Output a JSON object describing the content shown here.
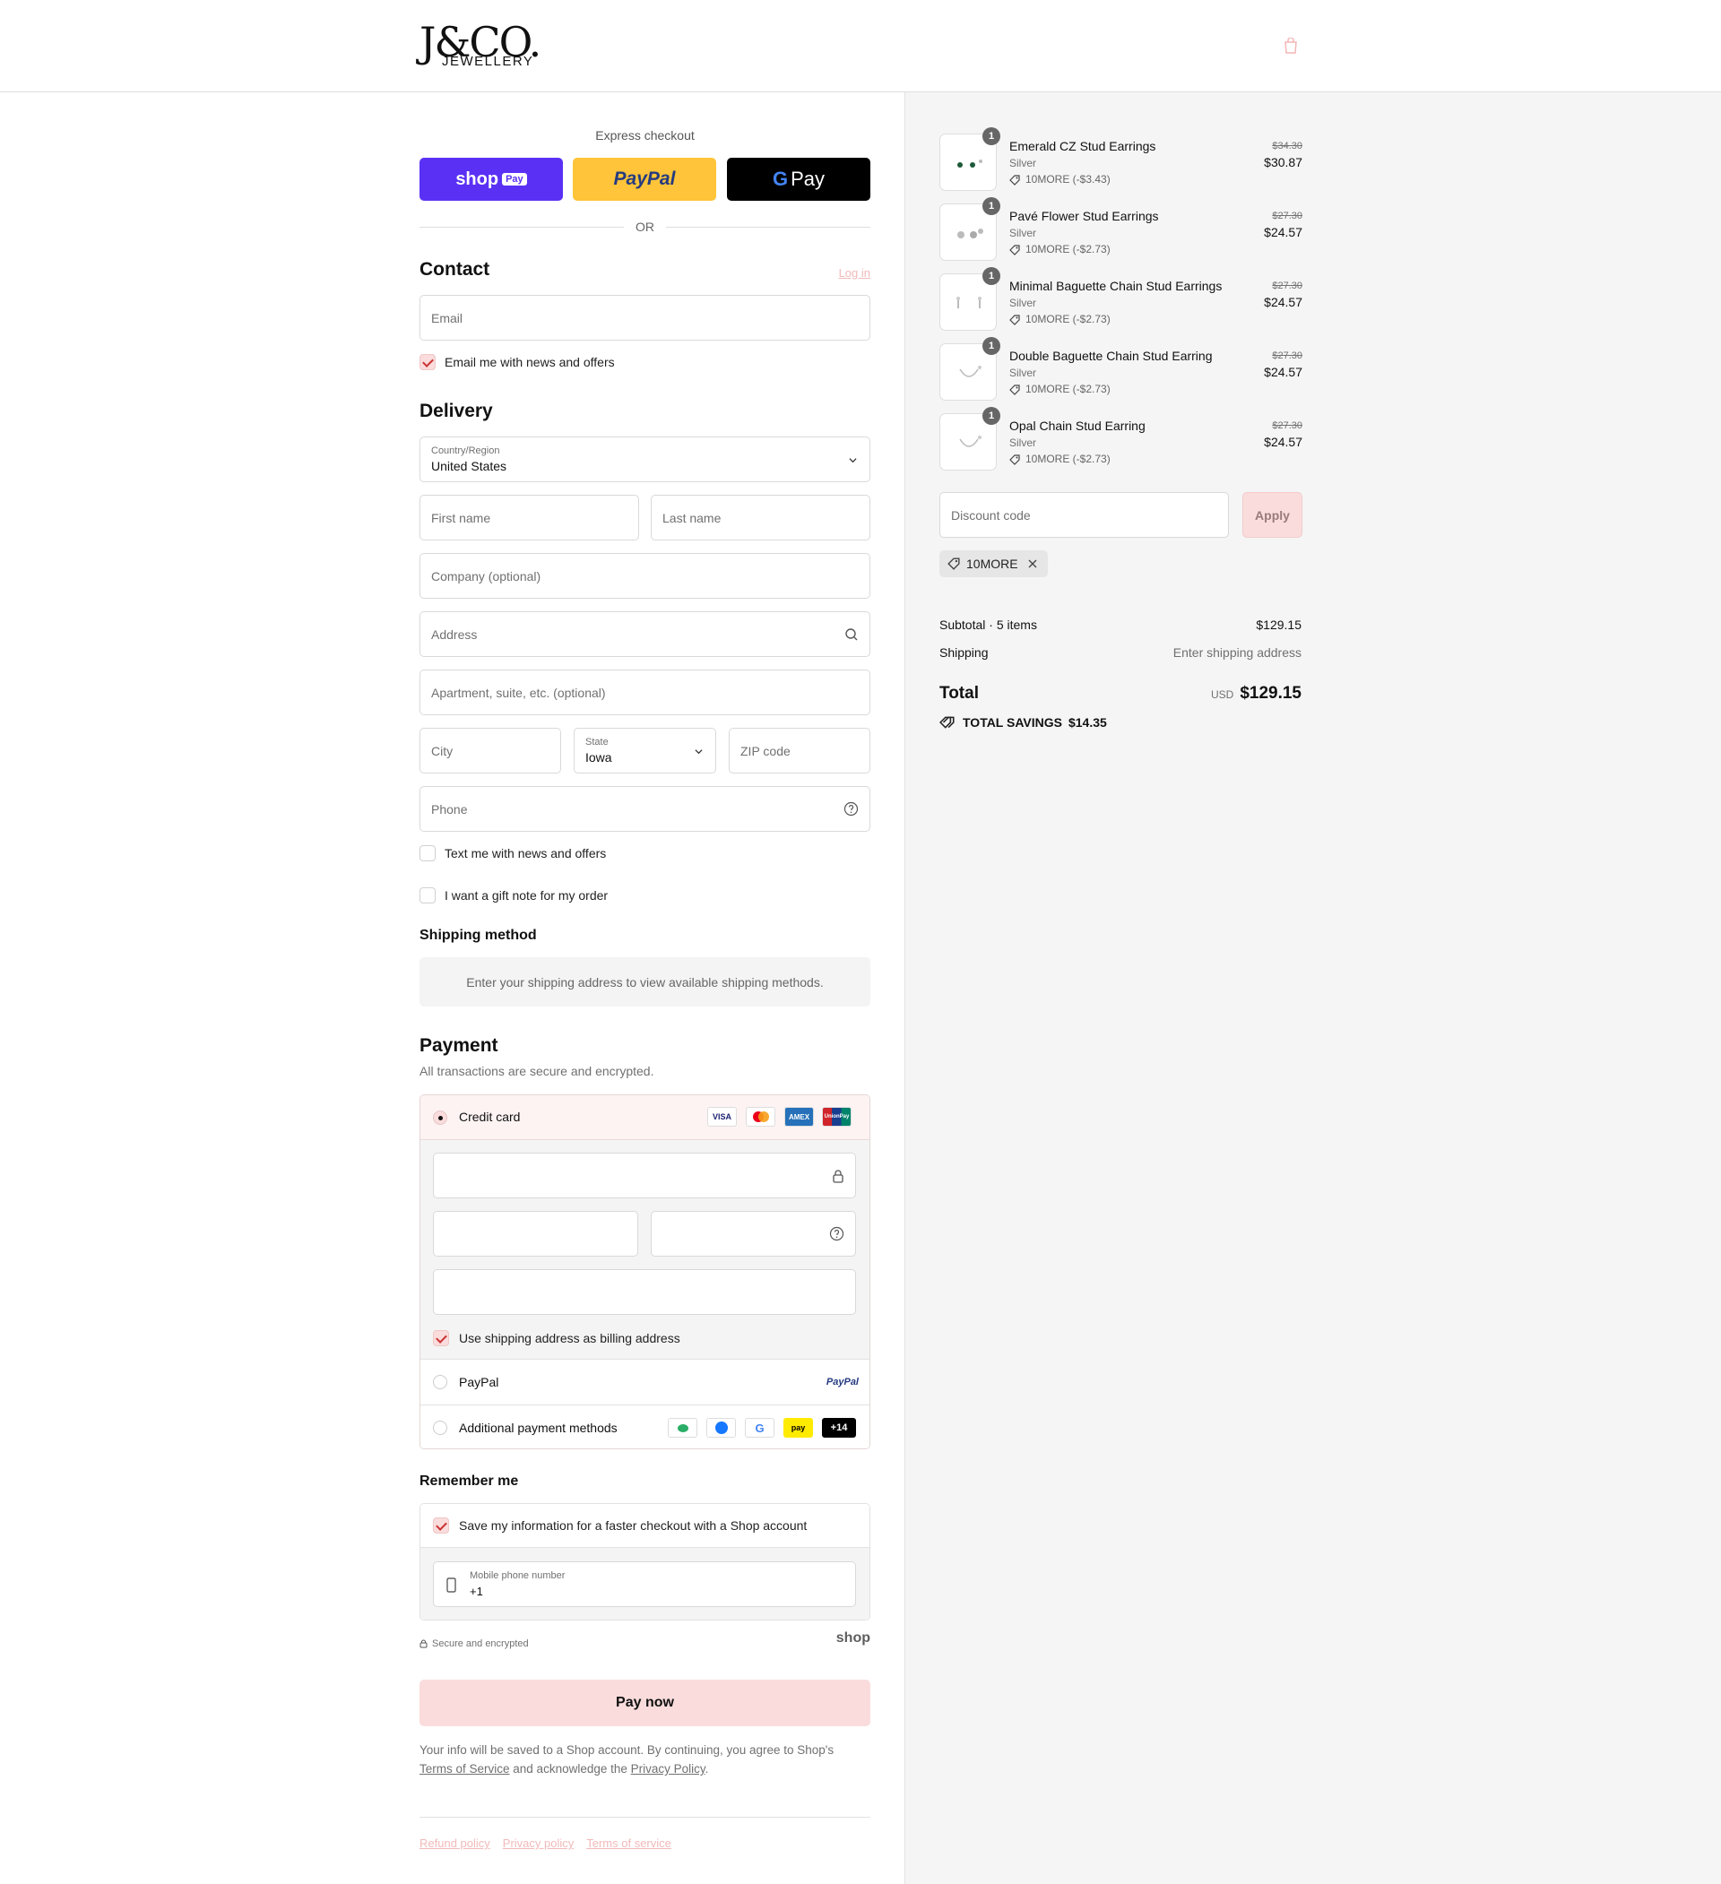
{
  "brand": {
    "logo_main": "J&CO.",
    "logo_sub": "JEWELLERY"
  },
  "express": {
    "title": "Express checkout",
    "shop_pay": "shop",
    "shop_pay_badge": "Pay",
    "paypal": "PayPal",
    "gpay": "Pay",
    "or": "OR"
  },
  "contact": {
    "title": "Contact",
    "login": "Log in",
    "email_placeholder": "Email",
    "news_label": "Email me with news and offers"
  },
  "delivery": {
    "title": "Delivery",
    "country_label": "Country/Region",
    "country_value": "United States",
    "first_name": "First name",
    "last_name": "Last name",
    "company": "Company (optional)",
    "address": "Address",
    "apartment": "Apartment, suite, etc. (optional)",
    "city": "City",
    "state_label": "State",
    "state_value": "Iowa",
    "zip": "ZIP code",
    "phone": "Phone",
    "text_label": "Text me with news and offers",
    "gift_label": "I want a gift note for my order"
  },
  "shipping_method": {
    "title": "Shipping method",
    "message": "Enter your shipping address to view available shipping methods."
  },
  "payment": {
    "title": "Payment",
    "subtitle": "All transactions are secure and encrypted.",
    "credit_card": "Credit card",
    "card_brands": [
      "VISA",
      "Mastercard",
      "AMEX",
      "UnionPay"
    ],
    "billing_label": "Use shipping address as billing address",
    "paypal": "PayPal",
    "paypal_logo": "PayPal",
    "additional": "Additional payment methods",
    "more_count": "+14",
    "kakao": "pay"
  },
  "remember": {
    "title": "Remember me",
    "save_label": "Save my information for a faster checkout with a Shop account",
    "mobile_label": "Mobile phone number",
    "mobile_value": "+1"
  },
  "secure": {
    "text": "Secure and encrypted",
    "shop_logo": "shop"
  },
  "pay_now": "Pay now",
  "legal": {
    "line1": "Your info will be saved to a Shop account. By continuing, you agree to Shop's",
    "terms": "Terms of Service",
    "mid": " and acknowledge the ",
    "privacy": "Privacy Policy",
    "end": "."
  },
  "footer_links": [
    "Refund policy",
    "Privacy policy",
    "Terms of service"
  ],
  "items": [
    {
      "qty": "1",
      "name": "Emerald CZ Stud Earrings",
      "variant": "Silver",
      "discount": "10MORE (-$3.43)",
      "original": "$34.30",
      "price": "$30.87"
    },
    {
      "qty": "1",
      "name": "Pavé Flower Stud Earrings",
      "variant": "Silver",
      "discount": "10MORE (-$2.73)",
      "original": "$27.30",
      "price": "$24.57"
    },
    {
      "qty": "1",
      "name": "Minimal Baguette Chain Stud Earrings",
      "variant": "Silver",
      "discount": "10MORE (-$2.73)",
      "original": "$27.30",
      "price": "$24.57"
    },
    {
      "qty": "1",
      "name": "Double Baguette Chain Stud Earring",
      "variant": "Silver",
      "discount": "10MORE (-$2.73)",
      "original": "$27.30",
      "price": "$24.57"
    },
    {
      "qty": "1",
      "name": "Opal Chain Stud Earring",
      "variant": "Silver",
      "discount": "10MORE (-$2.73)",
      "original": "$27.30",
      "price": "$24.57"
    }
  ],
  "discount": {
    "placeholder": "Discount code",
    "apply": "Apply",
    "code": "10MORE"
  },
  "summary": {
    "subtotal_label": "Subtotal · 5 items",
    "subtotal_value": "$129.15",
    "shipping_label": "Shipping",
    "shipping_value": "Enter shipping address",
    "total_label": "Total",
    "currency": "USD",
    "total_value": "$129.15",
    "savings_label": "TOTAL SAVINGS",
    "savings_value": "$14.35"
  },
  "colors": {
    "accent_pink": "#fadcdc",
    "shop_pay": "#5a31f4",
    "paypal_yellow": "#ffc439"
  }
}
